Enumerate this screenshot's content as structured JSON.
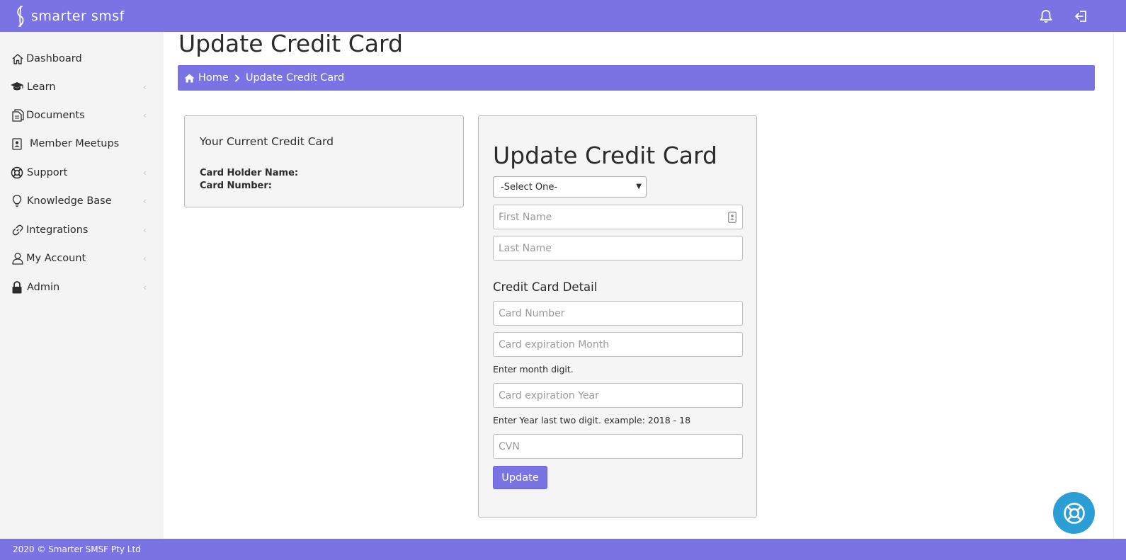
{
  "header": {
    "brand": "smarter smsf",
    "icons": [
      "bell-icon",
      "logout-icon"
    ]
  },
  "sidebar": {
    "items": [
      {
        "label": "Dashboard",
        "icon": "home-icon",
        "has_submenu": false
      },
      {
        "label": "Learn",
        "icon": "graduation-cap-icon",
        "has_submenu": true
      },
      {
        "label": "Documents",
        "icon": "documents-icon",
        "has_submenu": true
      },
      {
        "label": "Member Meetups",
        "icon": "contact-card-icon",
        "has_submenu": false
      },
      {
        "label": "Support",
        "icon": "life-ring-icon",
        "has_submenu": true
      },
      {
        "label": "Knowledge Base",
        "icon": "lightbulb-icon",
        "has_submenu": true
      },
      {
        "label": "Integrations",
        "icon": "link-icon",
        "has_submenu": true
      },
      {
        "label": "My Account",
        "icon": "user-icon",
        "has_submenu": true
      },
      {
        "label": "Admin",
        "icon": "lock-icon",
        "has_submenu": true
      }
    ]
  },
  "page": {
    "title": "Update Credit Card",
    "breadcrumb": {
      "home": "Home",
      "current": "Update Credit Card"
    }
  },
  "current_card": {
    "title": "Your Current Credit Card",
    "holder_label": "Card Holder Name:",
    "number_label": "Card Number:"
  },
  "form": {
    "title": "Update Credit Card",
    "select_value": "-Select One-",
    "first_name_placeholder": "First Name",
    "last_name_placeholder": "Last Name",
    "section_title": "Credit Card Detail",
    "card_number_placeholder": "Card Number",
    "exp_month_placeholder": "Card expiration Month",
    "exp_month_help": "Enter month digit.",
    "exp_year_placeholder": "Card expiration Year",
    "exp_year_help": "Enter Year last two digit. example: 2018 - 18",
    "cvn_placeholder": "CVN",
    "submit_label": "Update"
  },
  "footer": {
    "text": "2020 © Smarter SMSF Pty Ltd"
  },
  "colors": {
    "brand": "#7a73e3",
    "sidebar_bg": "#f4f4f4",
    "help_fab": "#2c9ed6"
  }
}
